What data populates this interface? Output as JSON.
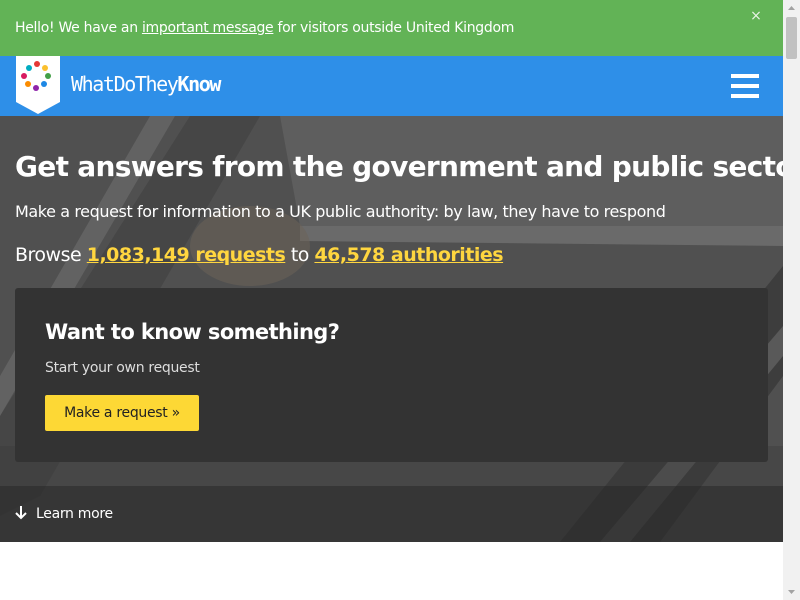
{
  "notice": {
    "prefix": "Hello! We have an ",
    "link": "important message",
    "suffix": " for visitors outside United Kingdom",
    "close": "×"
  },
  "header": {
    "logo_light": "WhatDoThey",
    "logo_bold": "Know",
    "menu_icon": "hamburger-icon"
  },
  "hero": {
    "title": "Get answers from the government and public sector",
    "subtitle": "Make a request for information to a UK public authority: by law, they have to respond",
    "browse_prefix": "Browse ",
    "requests_link": "1,083,149 requests",
    "browse_middle": " to ",
    "authorities_link": "46,578 authorities"
  },
  "card": {
    "title": "Want to know something?",
    "subtitle": "Start your own request",
    "button": "Make a request »"
  },
  "learn_more": {
    "label": "Learn more",
    "icon": "arrow-down-icon"
  },
  "colors": {
    "notice_bg": "#62b356",
    "header_bg": "#2e8fe8",
    "link_yellow": "#ffd63f",
    "button_yellow": "#fdd835",
    "card_bg": "#333333"
  }
}
